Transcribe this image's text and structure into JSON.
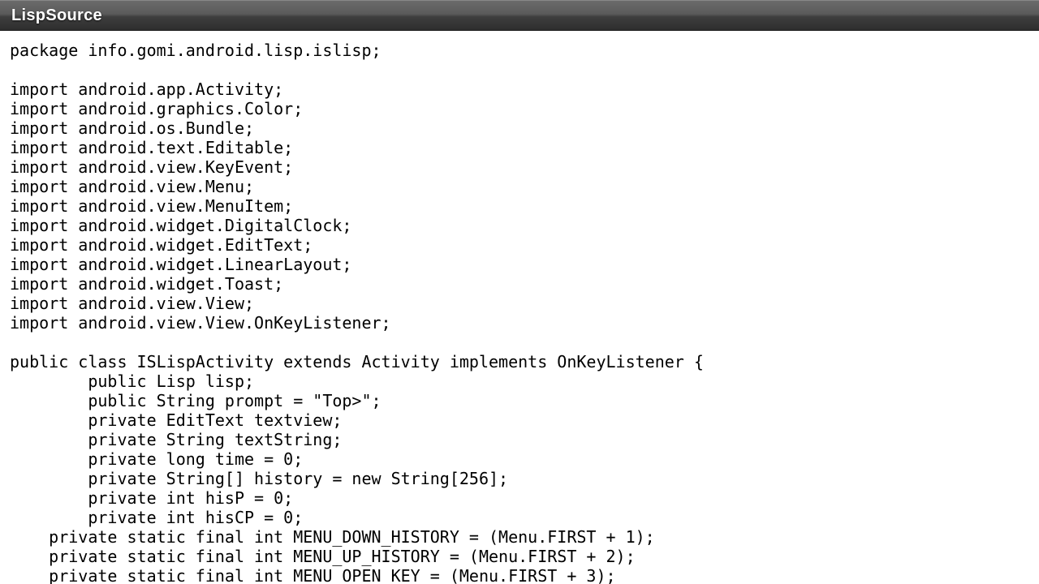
{
  "window": {
    "title": "LispSource"
  },
  "source": {
    "lines": [
      "package info.gomi.android.lisp.islisp;",
      "",
      "import android.app.Activity;",
      "import android.graphics.Color;",
      "import android.os.Bundle;",
      "import android.text.Editable;",
      "import android.view.KeyEvent;",
      "import android.view.Menu;",
      "import android.view.MenuItem;",
      "import android.widget.DigitalClock;",
      "import android.widget.EditText;",
      "import android.widget.LinearLayout;",
      "import android.widget.Toast;",
      "import android.view.View;",
      "import android.view.View.OnKeyListener;",
      "",
      "public class ISLispActivity extends Activity implements OnKeyListener {",
      "        public Lisp lisp;",
      "        public String prompt = \"Top>\";",
      "        private EditText textview;",
      "        private String textString;",
      "        private long time = 0;",
      "        private String[] history = new String[256];",
      "        private int hisP = 0;",
      "        private int hisCP = 0;",
      "    private static final int MENU_DOWN_HISTORY = (Menu.FIRST + 1);",
      "    private static final int MENU_UP_HISTORY = (Menu.FIRST + 2);",
      "    private static final int MENU_OPEN_KEY = (Menu.FIRST + 3);"
    ]
  }
}
